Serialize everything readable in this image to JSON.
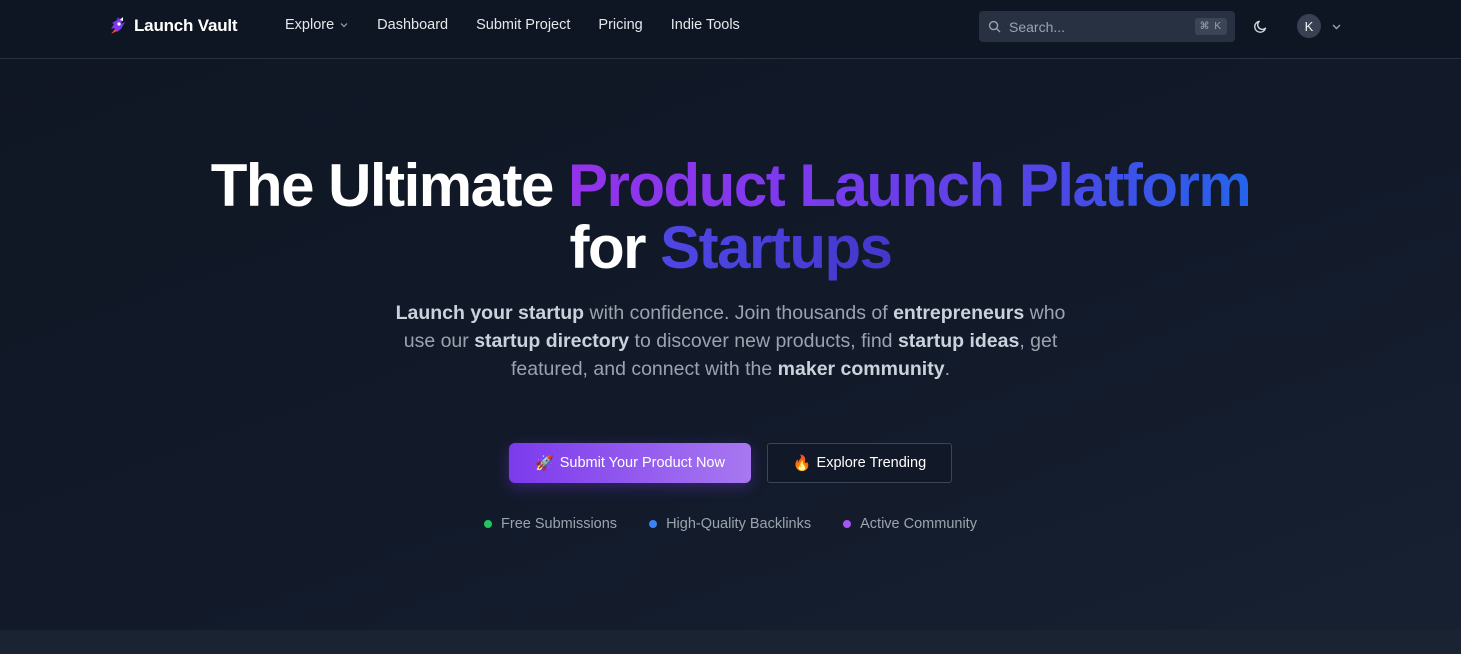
{
  "brand": {
    "name": "Launch Vault",
    "logo_icon": "rocket-logo-icon"
  },
  "nav": {
    "items": [
      {
        "label": "Explore",
        "has_dropdown": true
      },
      {
        "label": "Dashboard"
      },
      {
        "label": "Submit Project"
      },
      {
        "label": "Pricing"
      },
      {
        "label": "Indie Tools"
      }
    ]
  },
  "search": {
    "placeholder": "Search...",
    "shortcut": "⌘ K"
  },
  "user": {
    "initial": "K"
  },
  "hero": {
    "title_part1": "The Ultimate ",
    "title_highlight": "Product Launch Platform",
    "title_part2": "for ",
    "title_highlight2": "Startups",
    "subtitle": [
      {
        "text": "Launch your startup",
        "bold": true
      },
      {
        "text": " with confidence. Join thousands of ",
        "bold": false
      },
      {
        "text": "entrepreneurs",
        "bold": true
      },
      {
        "text": " who use our ",
        "bold": false
      },
      {
        "text": "startup directory",
        "bold": true
      },
      {
        "text": " to discover new products, find ",
        "bold": false
      },
      {
        "text": "startup ideas",
        "bold": true
      },
      {
        "text": ", get featured, and connect with the ",
        "bold": false
      },
      {
        "text": "maker community",
        "bold": true
      },
      {
        "text": ".",
        "bold": false
      }
    ],
    "primary_emoji": "🚀",
    "primary_label": "Submit Your Product Now",
    "secondary_emoji": "🔥",
    "secondary_label": "Explore Trending"
  },
  "features": [
    {
      "label": "Free Submissions",
      "color": "#22c55e"
    },
    {
      "label": "High-Quality Backlinks",
      "color": "#3b82f6"
    },
    {
      "label": "Active Community",
      "color": "#a855f7"
    }
  ],
  "colors": {
    "accent_purple": "#7c3aed",
    "accent_blue": "#2563eb",
    "background": "#111827"
  }
}
